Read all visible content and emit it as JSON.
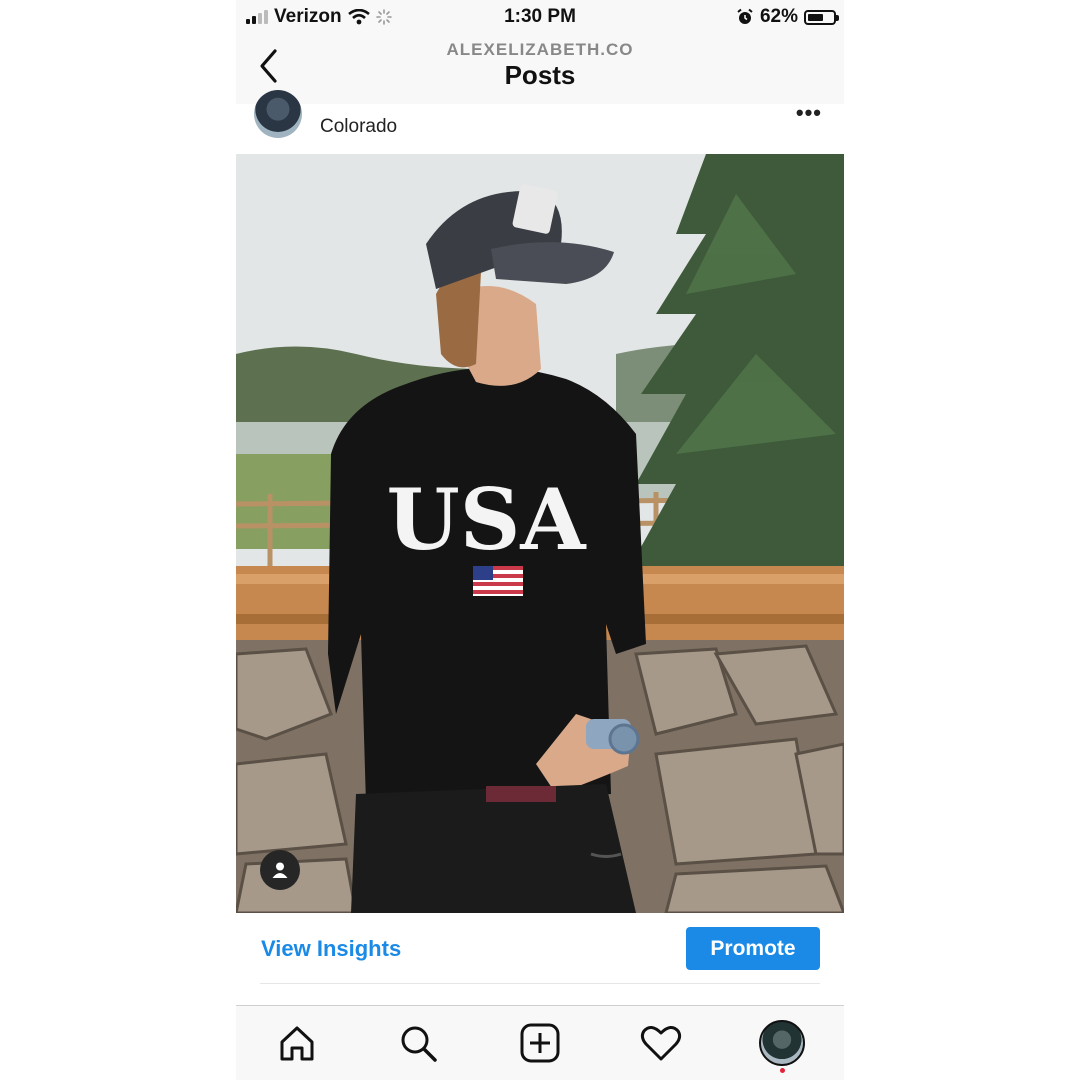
{
  "status_bar": {
    "carrier": "Verizon",
    "time": "1:30 PM",
    "battery_percent": "62%",
    "battery_level": 0.62,
    "icons": [
      "signal-icon",
      "wifi-icon",
      "loading-icon",
      "alarm-icon",
      "battery-icon"
    ]
  },
  "header": {
    "username": "ALEXELIZABETH.CO",
    "title": "Posts",
    "back_icon": "chevron-left-icon"
  },
  "post": {
    "location": "Colorado",
    "more_icon": "more-horizontal-icon",
    "photo": {
      "shirt_text": "USA",
      "tag_icon": "user-tag-icon"
    },
    "view_insights_label": "View Insights",
    "promote_label": "Promote"
  },
  "colors": {
    "accent": "#1a8ae6",
    "notification_dot": "#e0243a"
  },
  "tab_bar": {
    "items": [
      "home-icon",
      "search-icon",
      "add-post-icon",
      "heart-icon",
      "profile-avatar"
    ],
    "active": "profile-avatar"
  }
}
